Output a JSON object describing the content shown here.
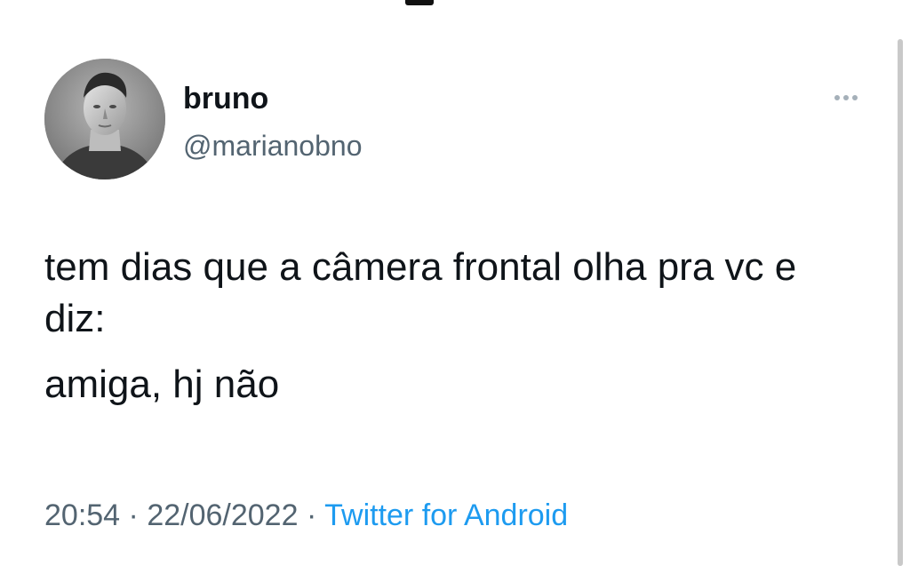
{
  "tweet": {
    "author": {
      "display_name": "bruno",
      "handle": "@marianobno",
      "avatar_icon": "profile-photo-monochrome"
    },
    "more_icon": "more-horizontal-icon",
    "text_lines": [
      "tem dias que a câmera frontal olha pra vc e diz:",
      "amiga, hj não"
    ],
    "time": "20:54",
    "separator": "·",
    "date": "22/06/2022",
    "source": "Twitter for Android"
  },
  "colors": {
    "text_primary": "#0f1419",
    "text_secondary": "#536471",
    "link": "#1d9bf0"
  }
}
